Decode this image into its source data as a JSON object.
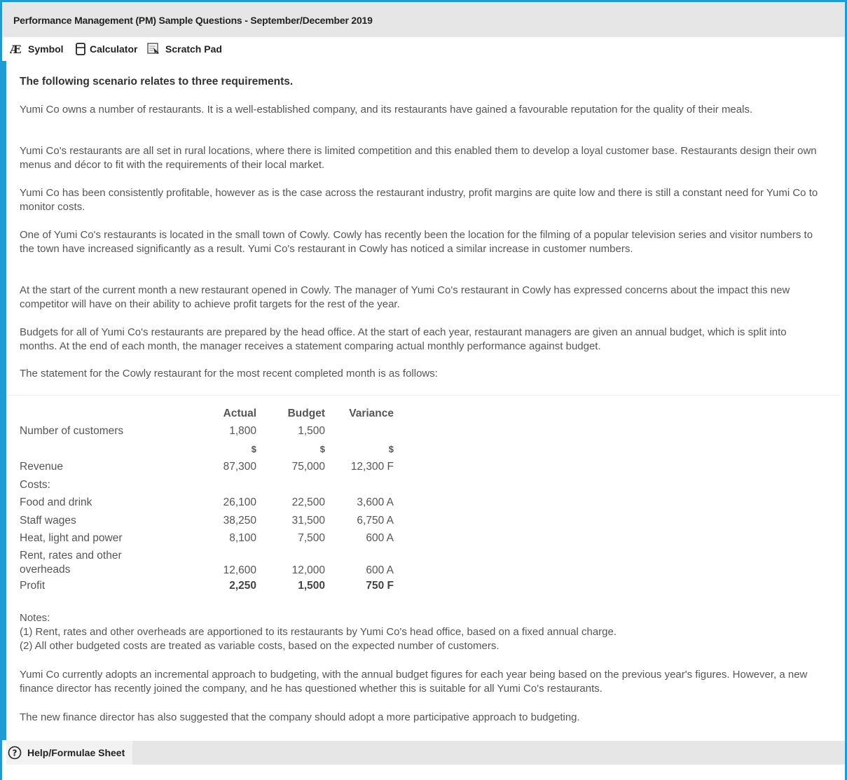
{
  "window": {
    "title": "Performance Management (PM) Sample Questions - September/December 2019"
  },
  "toolbar": {
    "symbol_label": "Symbol",
    "calculator_label": "Calculator",
    "scratch_pad_label": "Scratch Pad"
  },
  "content": {
    "heading": "The following scenario relates to three requirements.",
    "paragraphs": [
      "Yumi Co owns a number of restaurants. It is a well-established company, and its restaurants have gained a favourable reputation for the quality of their meals.",
      "Yumi Co's restaurants are all set in rural locations, where there is limited competition and this enabled them to develop a loyal customer base. Restaurants design their own menus and décor to fit with the requirements of their local market.",
      "Yumi Co has been consistently profitable, however as is the case across the restaurant industry, profit margins are quite low and there is still a constant need for Yumi Co to monitor costs.",
      "One of Yumi Co's restaurants is located in the small town of Cowly. Cowly has recently been the location for the filming of a popular television series and visitor numbers to the town have increased significantly as a result. Yumi Co's restaurant in Cowly has noticed a similar increase in customer numbers.",
      "At the start of the current month a new restaurant opened in Cowly. The manager of Yumi Co's restaurant in Cowly has expressed concerns about the impact this new competitor will have on their ability to achieve profit targets for the rest of the year.",
      "Budgets for all of Yumi Co's restaurants are prepared by the head office. At the start of each year, restaurant managers are given an annual budget, which is split into months. At the end of each month, the manager receives a statement comparing actual monthly performance against budget.",
      "The statement for the Cowly restaurant for the most recent completed month is as follows:"
    ]
  },
  "statement": {
    "headers": [
      "Actual",
      "Budget",
      "Variance"
    ],
    "customers": {
      "label": "Number of customers",
      "actual": "1,800",
      "budget": "1,500",
      "variance": ""
    },
    "currency": [
      "$",
      "$",
      "$"
    ],
    "revenue": {
      "label": "Revenue",
      "actual": "87,300",
      "budget": "75,000",
      "variance": "12,300 F"
    },
    "costs_label": "Costs:",
    "food": {
      "label": "Food and drink",
      "actual": "26,100",
      "budget": "22,500",
      "variance": "3,600 A"
    },
    "wages": {
      "label": "Staff wages",
      "actual": "38,250",
      "budget": "31,500",
      "variance": "6,750 A"
    },
    "heat": {
      "label": "Heat, light and power",
      "actual": "8,100",
      "budget": "7,500",
      "variance": "600 A"
    },
    "rent": {
      "label_line1": "Rent, rates and other",
      "label_line2": "overheads",
      "actual": "12,600",
      "budget": "12,000",
      "variance": "600 A"
    },
    "profit": {
      "label": "Profit",
      "actual": "2,250",
      "budget": "1,500",
      "variance": "750 F"
    }
  },
  "notes": {
    "title": "Notes:",
    "note1": "(1) Rent, rates and other overheads are apportioned to its restaurants by Yumi Co's head office, based on a fixed annual charge.",
    "note2": "(2) All other budgeted costs are treated as variable costs, based on the expected number of customers.",
    "para1": "Yumi Co currently adopts an incremental approach to budgeting, with the annual budget figures for each year being based on the previous year's figures. However, a new finance director has recently joined the company, and he has questioned whether this is suitable for all Yumi Co's restaurants.",
    "para2": "The new finance director has also suggested that the company should adopt a more participative approach to budgeting."
  },
  "footer": {
    "help_label": "Help/Formulae Sheet"
  },
  "colors": {
    "accent": "#1e9bd7",
    "bar_bg": "#e6e6e6"
  }
}
